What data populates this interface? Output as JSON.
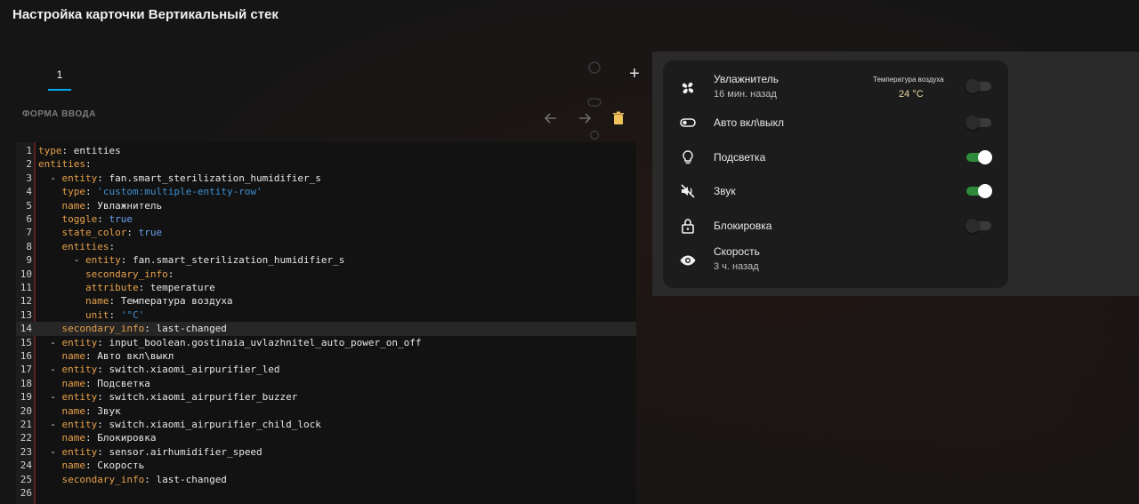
{
  "page": {
    "title": "Настройка карточки Вертикальный стек"
  },
  "tabs": {
    "active_label": "1"
  },
  "editor": {
    "section_label": "ФОРМА ВВОДА",
    "lines": [
      {
        "n": "1",
        "t": [
          [
            "k",
            "type"
          ],
          [
            "v",
            ": entities"
          ]
        ]
      },
      {
        "n": "2",
        "t": [
          [
            "k",
            "entities"
          ],
          [
            "v",
            ":"
          ]
        ]
      },
      {
        "n": "3",
        "t": [
          [
            "v",
            "  - "
          ],
          [
            "k",
            "entity"
          ],
          [
            "v",
            ": fan.smart_sterilization_humidifier_s"
          ]
        ]
      },
      {
        "n": "4",
        "t": [
          [
            "v",
            "    "
          ],
          [
            "k",
            "type"
          ],
          [
            "v",
            ": "
          ],
          [
            "s",
            "'custom:multiple-entity-row'"
          ]
        ]
      },
      {
        "n": "5",
        "t": [
          [
            "v",
            "    "
          ],
          [
            "k",
            "name"
          ],
          [
            "v",
            ": Увлажнитель"
          ]
        ]
      },
      {
        "n": "6",
        "t": [
          [
            "v",
            "    "
          ],
          [
            "k",
            "toggle"
          ],
          [
            "v",
            ": "
          ],
          [
            "b",
            "true"
          ]
        ]
      },
      {
        "n": "7",
        "t": [
          [
            "v",
            "    "
          ],
          [
            "k",
            "state_color"
          ],
          [
            "v",
            ": "
          ],
          [
            "b",
            "true"
          ]
        ]
      },
      {
        "n": "8",
        "t": [
          [
            "v",
            "    "
          ],
          [
            "k",
            "entities"
          ],
          [
            "v",
            ":"
          ]
        ]
      },
      {
        "n": "9",
        "t": [
          [
            "v",
            "      - "
          ],
          [
            "k",
            "entity"
          ],
          [
            "v",
            ": fan.smart_sterilization_humidifier_s"
          ]
        ]
      },
      {
        "n": "10",
        "t": [
          [
            "v",
            "        "
          ],
          [
            "k",
            "secondary_info"
          ],
          [
            "v",
            ":"
          ]
        ]
      },
      {
        "n": "11",
        "t": [
          [
            "v",
            "        "
          ],
          [
            "k",
            "attribute"
          ],
          [
            "v",
            ": temperature"
          ]
        ]
      },
      {
        "n": "12",
        "t": [
          [
            "v",
            "        "
          ],
          [
            "k",
            "name"
          ],
          [
            "v",
            ": Температура воздуха"
          ]
        ]
      },
      {
        "n": "13",
        "t": [
          [
            "v",
            "        "
          ],
          [
            "k",
            "unit"
          ],
          [
            "v",
            ": "
          ],
          [
            "s",
            "'°C'"
          ]
        ]
      },
      {
        "n": "14",
        "t": [
          [
            "v",
            "    "
          ],
          [
            "k",
            "secondary_info"
          ],
          [
            "v",
            ": last-changed"
          ]
        ],
        "active": true
      },
      {
        "n": "15",
        "t": [
          [
            "v",
            "  - "
          ],
          [
            "k",
            "entity"
          ],
          [
            "v",
            ": input_boolean.gostinaia_uvlazhnitel_auto_power_on_off"
          ]
        ]
      },
      {
        "n": "16",
        "t": [
          [
            "v",
            "    "
          ],
          [
            "k",
            "name"
          ],
          [
            "v",
            ": Авто вкл\\выкл"
          ]
        ]
      },
      {
        "n": "17",
        "t": [
          [
            "v",
            "  - "
          ],
          [
            "k",
            "entity"
          ],
          [
            "v",
            ": switch.xiaomi_airpurifier_led"
          ]
        ]
      },
      {
        "n": "18",
        "t": [
          [
            "v",
            "    "
          ],
          [
            "k",
            "name"
          ],
          [
            "v",
            ": Подсветка"
          ]
        ]
      },
      {
        "n": "19",
        "t": [
          [
            "v",
            "  - "
          ],
          [
            "k",
            "entity"
          ],
          [
            "v",
            ": switch.xiaomi_airpurifier_buzzer"
          ]
        ]
      },
      {
        "n": "20",
        "t": [
          [
            "v",
            "    "
          ],
          [
            "k",
            "name"
          ],
          [
            "v",
            ": Звук"
          ]
        ]
      },
      {
        "n": "21",
        "t": [
          [
            "v",
            "  - "
          ],
          [
            "k",
            "entity"
          ],
          [
            "v",
            ": switch.xiaomi_airpurifier_child_lock"
          ]
        ]
      },
      {
        "n": "22",
        "t": [
          [
            "v",
            "    "
          ],
          [
            "k",
            "name"
          ],
          [
            "v",
            ": Блокировка"
          ]
        ]
      },
      {
        "n": "23",
        "t": [
          [
            "v",
            "  - "
          ],
          [
            "k",
            "entity"
          ],
          [
            "v",
            ": sensor.airhumidifier_speed"
          ]
        ]
      },
      {
        "n": "24",
        "t": [
          [
            "v",
            "    "
          ],
          [
            "k",
            "name"
          ],
          [
            "v",
            ": Скорость"
          ]
        ]
      },
      {
        "n": "25",
        "t": [
          [
            "v",
            "    "
          ],
          [
            "k",
            "secondary_info"
          ],
          [
            "v",
            ": last-changed"
          ]
        ]
      },
      {
        "n": "26",
        "t": []
      }
    ]
  },
  "preview": {
    "rows": [
      {
        "name": "Увлажнитель",
        "secondary": "16 мин. назад",
        "icon": "fan-icon",
        "toggle": "off",
        "attr_label": "Температура воздуха",
        "attr_value": "24 °C"
      },
      {
        "name": "Авто вкл\\выкл",
        "icon": "toggle-switch-icon",
        "toggle": "off"
      },
      {
        "name": "Подсветка",
        "icon": "lightbulb-icon",
        "toggle": "on"
      },
      {
        "name": "Звук",
        "icon": "volume-off-icon",
        "toggle": "on"
      },
      {
        "name": "Блокировка",
        "icon": "lock-icon",
        "toggle": "off"
      },
      {
        "name": "Скорость",
        "secondary": "3 ч. назад",
        "icon": "eye-icon"
      }
    ]
  },
  "colors": {
    "accent": "#03a9f4",
    "toggle_on": "#2e8b3a",
    "yaml_key": "#e6a04a",
    "yaml_string": "#3e8fd0"
  }
}
